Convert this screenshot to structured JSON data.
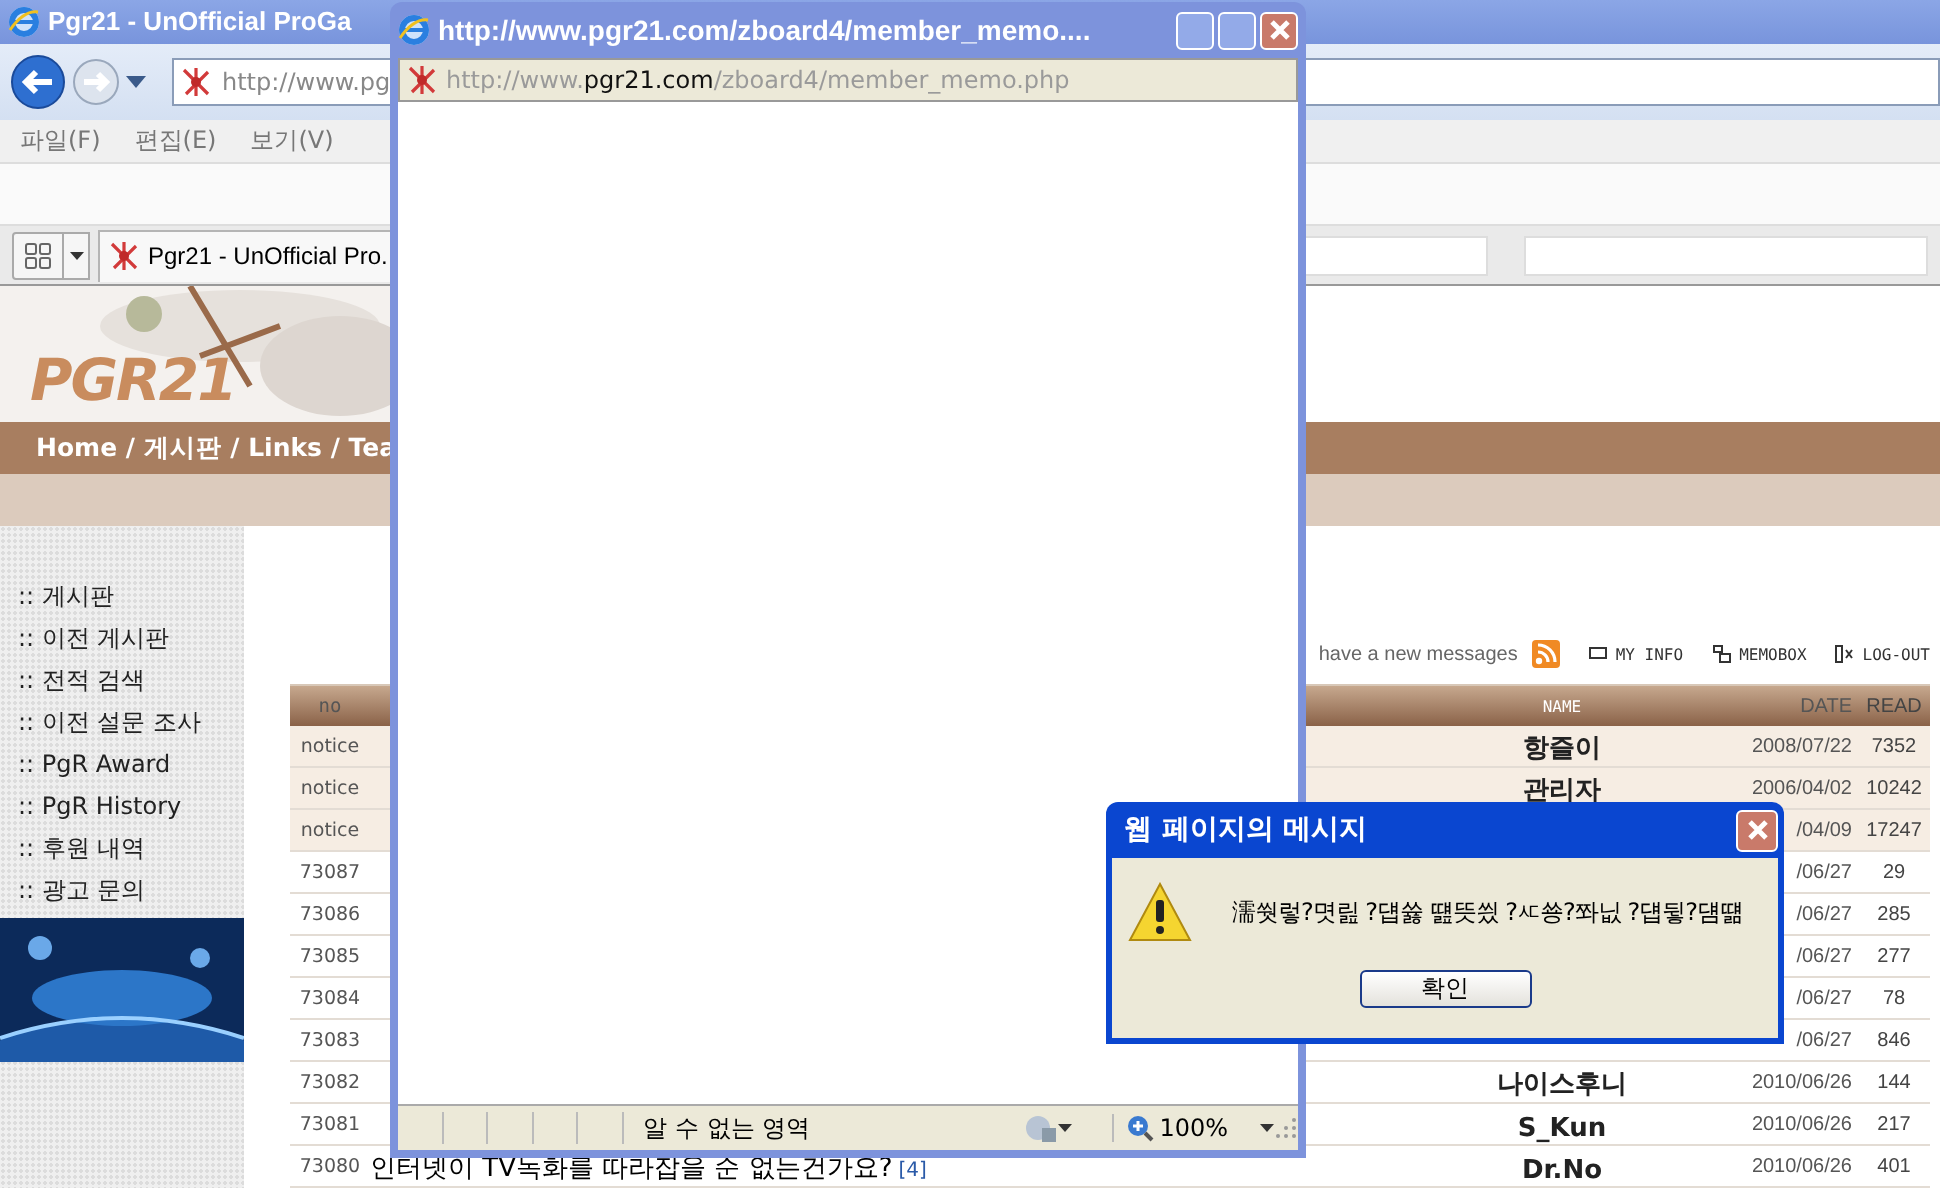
{
  "browser": {
    "title": "Pgr21 - UnOfficial ProGa",
    "address": "http://www.pg",
    "menu": [
      "파일(F)",
      "편집(E)",
      "보기(V)"
    ],
    "tab": "Pgr21 - UnOfficial Pro."
  },
  "site": {
    "logo": "PGR21",
    "nav": "Home / 게시판 / Links / Tea",
    "sidebar": [
      "게시판",
      "이전 게시판",
      "전적 검색",
      "이전 설문 조사",
      "PgR Award",
      "PgR History",
      "후원 내역",
      "광고 문의"
    ],
    "sidebar_marker": "::",
    "user_links": {
      "message": "have a new messages",
      "links": [
        "MY INFO",
        "MEMOBOX",
        "LOG-OUT"
      ]
    }
  },
  "board": {
    "columns": [
      "no",
      "NAME",
      "DATE",
      "READ"
    ],
    "rows": [
      {
        "kind": "notice",
        "no": "notice",
        "name": "항즐이",
        "date": "2008/07/22",
        "read": "7352"
      },
      {
        "kind": "notice",
        "no": "notice",
        "name": "관리자",
        "date": "2006/04/02",
        "read": "10242"
      },
      {
        "kind": "notice",
        "no": "notice",
        "date": "/04/09",
        "read": "17247"
      },
      {
        "kind": "post",
        "no": "73087",
        "date": "/06/27",
        "read": "29"
      },
      {
        "kind": "post",
        "no": "73086",
        "date": "/06/27",
        "read": "285"
      },
      {
        "kind": "post",
        "no": "73085",
        "date": "/06/27",
        "read": "277"
      },
      {
        "kind": "post",
        "no": "73084",
        "date": "/06/27",
        "read": "78"
      },
      {
        "kind": "post",
        "no": "73083",
        "date": "/06/27",
        "read": "846"
      },
      {
        "kind": "post",
        "no": "73082",
        "name": "나이스후니",
        "date": "2010/06/26",
        "read": "144"
      },
      {
        "kind": "post",
        "no": "73081",
        "name": "S_Kun",
        "date": "2010/06/26",
        "read": "217"
      },
      {
        "kind": "post",
        "no": "73080",
        "title": "인터넷이 TV녹화를 따라잡을 순 없는건가요?",
        "comments": "[4]",
        "name": "Dr.No",
        "date": "2010/06/26",
        "read": "401"
      }
    ]
  },
  "popup": {
    "title": "http://www.pgr21.com/zboard4/member_memo....",
    "address": {
      "prefix": "http://www.",
      "domain": "pgr21.com",
      "path": "/zboard4/member_memo.php"
    },
    "status": "알 수 없는 영역",
    "zoom": "100%"
  },
  "dialog": {
    "title": "웹 페이지의 메시지",
    "message": "濡쒓렇?몃릺 ?덉쓣 떒뜻씠 ?ㅼ쑝?쫘닚 ?덉뒿?덈떎",
    "button": "확인"
  }
}
